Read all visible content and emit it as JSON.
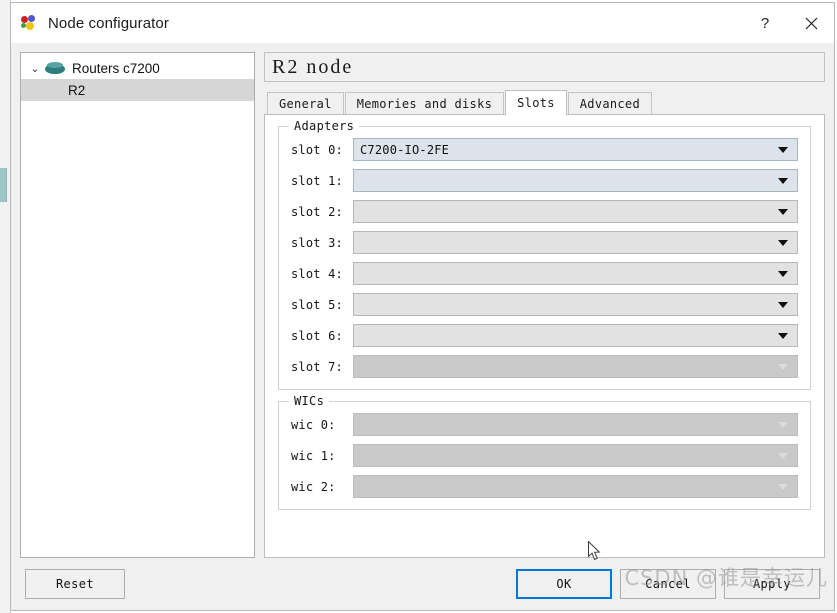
{
  "window": {
    "title": "Node configurator",
    "icon": "gns3-dots-icon",
    "help_button": "?",
    "close_button": "✕"
  },
  "sidebar": {
    "root": {
      "label": "Routers c7200",
      "chevron": "⌄",
      "icon": "router-icon",
      "expanded": true
    },
    "children": [
      {
        "label": "R2",
        "selected": true
      }
    ]
  },
  "content": {
    "node_header": "R2 node",
    "tabs": [
      {
        "label": "General",
        "active": false
      },
      {
        "label": "Memories and disks",
        "active": false
      },
      {
        "label": "Slots",
        "active": true
      },
      {
        "label": "Advanced",
        "active": false
      }
    ],
    "adapters": {
      "title": "Adapters",
      "rows": [
        {
          "label": "slot 0:",
          "value": "C7200-IO-2FE",
          "state": "active"
        },
        {
          "label": "slot 1:",
          "value": "",
          "state": "active"
        },
        {
          "label": "slot 2:",
          "value": "",
          "state": "plain"
        },
        {
          "label": "slot 3:",
          "value": "",
          "state": "plain"
        },
        {
          "label": "slot 4:",
          "value": "",
          "state": "plain"
        },
        {
          "label": "slot 5:",
          "value": "",
          "state": "plain"
        },
        {
          "label": "slot 6:",
          "value": "",
          "state": "plain"
        },
        {
          "label": "slot 7:",
          "value": "",
          "state": "disabled"
        }
      ]
    },
    "wics": {
      "title": "WICs",
      "rows": [
        {
          "label": "wic 0:",
          "value": "",
          "state": "disabled"
        },
        {
          "label": "wic 1:",
          "value": "",
          "state": "disabled"
        },
        {
          "label": "wic 2:",
          "value": "",
          "state": "disabled"
        }
      ]
    }
  },
  "footer": {
    "reset": "Reset",
    "ok": "OK",
    "cancel": "Cancel",
    "apply": "Apply"
  },
  "watermark": {
    "text": "CSDN @谁是幸运儿"
  },
  "colors": {
    "accent": "#0078d7",
    "combo_active_bg": "#dde3ea",
    "combo_plain_bg": "#e2e2e2",
    "combo_disabled_bg": "#c9c9c9",
    "selection_bg": "#d6d6d6",
    "router_icon": "#2e7d7d",
    "window_bg": "#f0f0f0"
  }
}
